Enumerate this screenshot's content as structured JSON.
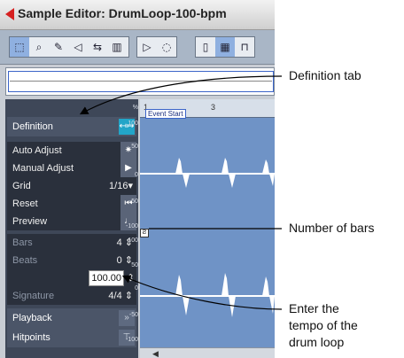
{
  "window": {
    "title": "Sample Editor: DrumLoop-100-bpm"
  },
  "panel": {
    "definition_label": "Definition",
    "auto_adjust_label": "Auto Adjust",
    "manual_adjust_label": "Manual Adjust",
    "grid_label": "Grid",
    "grid_value": "1/16",
    "reset_label": "Reset",
    "preview_label": "Preview",
    "bars_label": "Bars",
    "bars_value": "4",
    "beats_label": "Beats",
    "beats_value": "0",
    "tempo_value": "100.00",
    "signature_label": "Signature",
    "signature_value": "4/4",
    "playback_label": "Playback",
    "hitpoints_label": "Hitpoints"
  },
  "ruler": {
    "marks": [
      "1",
      "3"
    ],
    "event_start_label": "Event Start"
  },
  "scale": {
    "labels": [
      "%",
      "100",
      "50",
      "0",
      "-50",
      "-100",
      "100",
      "50",
      "0",
      "-50",
      "-100"
    ]
  },
  "callouts": {
    "definition_tab": "Definition tab",
    "number_of_bars": "Number of bars",
    "tempo": [
      "Enter the",
      "tempo of the",
      "drum loop"
    ]
  },
  "colors": {
    "accent": "#22a5c8",
    "editor_bg": "#6f93c6",
    "panel_bg": "#3e4758"
  },
  "icons": [
    "back-arrow-icon",
    "range-select-icon",
    "zoom-icon",
    "pencil-icon",
    "speaker-icon",
    "audition-icon",
    "grid-icon",
    "play-icon",
    "loop-icon",
    "snap-icon",
    "hitpoint-icon"
  ]
}
